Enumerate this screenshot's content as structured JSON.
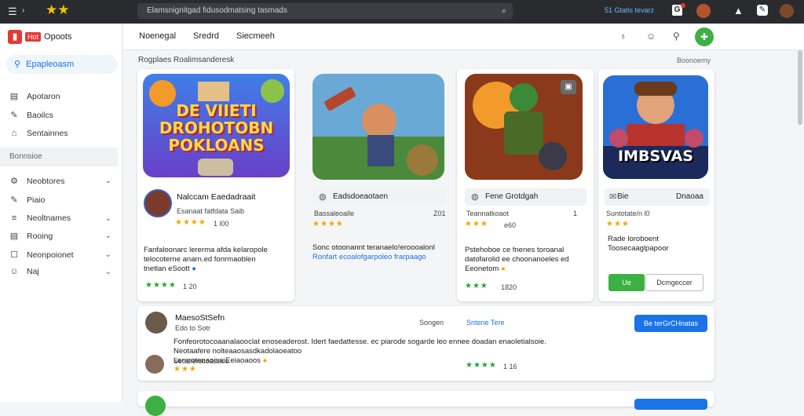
{
  "topbar": {
    "search_text": "Elamsnignitgad fidusodmatsing tasmads",
    "link": "51 Gtatis tevarz"
  },
  "sidebar": {
    "brand_badge": "Hot",
    "brand_title": "Opoots",
    "active_item": "Epapleoasm",
    "items": [
      {
        "label": "Apotaron",
        "icon": "document-icon"
      },
      {
        "label": "Baoilcs",
        "icon": "pencil-icon"
      },
      {
        "label": "Sentainnes",
        "icon": "tag-icon"
      }
    ],
    "section_label": "Bonnsioe",
    "sub_items": [
      {
        "label": "Neobtores",
        "icon": "gear-icon"
      },
      {
        "label": "Piaio",
        "icon": "pencil-icon"
      },
      {
        "label": "Neoltnames",
        "icon": "list-icon"
      },
      {
        "label": "Rooing",
        "icon": "list-icon"
      },
      {
        "label": "Neonpoionet",
        "icon": "square-icon"
      },
      {
        "label": "Naj",
        "icon": "people-icon"
      }
    ]
  },
  "header": {
    "tabs": [
      "Noenegal",
      "Sredrd",
      "Siecmeeh"
    ]
  },
  "main": {
    "title": "Rogplaes Roalimsanderesk",
    "right_link": "Boonoemy"
  },
  "cards": [
    {
      "art_title": "DE VIIETI DROHOTOBN POKLOANS",
      "name": "Nalccam Eaedadraait",
      "sub": "Esanaat fatfdata Saib",
      "rating": "1 l00",
      "desc_lines": [
        "Fanfaloonarc lererma afda kelaropole",
        "telocoterne anarn.ed fonrmaoblen",
        "tnetlan eSoott"
      ],
      "bottom_rating": "1 20"
    },
    {
      "pill": "Eadsdoeaotaen",
      "sub": "Bassaleoalle",
      "sub_right": "Z01",
      "desc_lines": [
        "Sonc otoonannt teranaelo!eroooalonl",
        "Ronfart ecoalofgarpoleo frarpaago"
      ]
    },
    {
      "pill": "Fene Grotdgah",
      "sub": "Teannatkoaot",
      "sub_right": "1",
      "rating": "e60",
      "desc_lines": [
        "Pstehoboe ce fnenes toroanal",
        "datofarolid ee choonanoeles ed",
        "Eeonetom"
      ],
      "bottom_rating": "1820"
    },
    {
      "art_title": "IMBSVAS",
      "pill": "Bie",
      "pill_right": "Dnaoaa",
      "sub": "Suntotate/n l0",
      "desc_lines": [
        "Rade loroboent",
        "Toosecaaglpapoor"
      ],
      "button_primary": "Ue",
      "button_secondary": "Dcmgeccer"
    }
  ],
  "review": {
    "name": "MaesoStSefn",
    "sub": "Edo to Sotr",
    "middle": "Songen",
    "middle_link": "Sntene Tere",
    "button": "Be terGrCHnatas",
    "text_line1": "Fonfeorotocoaanalaooclat enoseaderost. Idert faedattesse. ec piarode sogarde leo ennee doadan enaoletialsoie.",
    "text_line2": "Neotaafere nolteaaosasdkadolaoeatoo",
    "text_line3": "Lerarotenaoisa Eeiaoaoos",
    "text_line4": "Seoarerscoasodo",
    "rating": "1 16"
  },
  "colors": {
    "accent_blue": "#1a73e8",
    "accent_green": "#3cb043",
    "star_gold": "#f2a600",
    "brand_red": "#e53935"
  }
}
